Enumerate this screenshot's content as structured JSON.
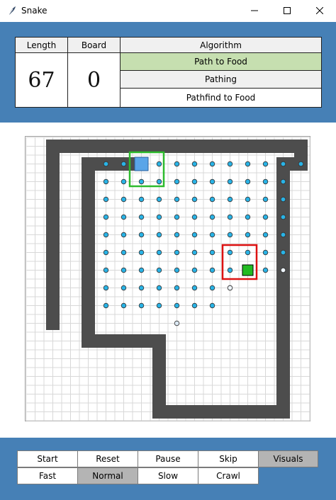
{
  "window": {
    "title": "Snake",
    "controls": [
      "minimize-icon",
      "maximize-icon",
      "close-icon"
    ]
  },
  "stats": {
    "length_label": "Length",
    "length_value": "67",
    "board_label": "Board",
    "board_value": "0"
  },
  "algorithm": {
    "header": "Algorithm",
    "items": [
      {
        "label": "Path to Food",
        "color": "#c6dfb0",
        "selected": true
      },
      {
        "label": "Pathing",
        "color": "#f0f0f0",
        "selected": false
      },
      {
        "label": "Pathfind to Food",
        "color": "#ffffff",
        "selected": false
      }
    ]
  },
  "board": {
    "cols": 16,
    "rows": 16,
    "colors": {
      "snake_body": "#4d4d4d",
      "snake_head": "#5aa5e8",
      "head_marker": "#2dbb2d",
      "food": "#22bb22",
      "food_marker": "#dd1111",
      "path_dot": "#29b3e6",
      "grid": "#d8d8d8"
    }
  },
  "controls": {
    "row1": [
      {
        "label": "Start",
        "active": false
      },
      {
        "label": "Reset",
        "active": false
      },
      {
        "label": "Pause",
        "active": false
      },
      {
        "label": "Skip",
        "active": false
      },
      {
        "label": "Visuals",
        "active": true
      }
    ],
    "row2": [
      {
        "label": "Fast",
        "active": false
      },
      {
        "label": "Normal",
        "active": true
      },
      {
        "label": "Slow",
        "active": false
      },
      {
        "label": "Crawl",
        "active": false
      }
    ]
  }
}
